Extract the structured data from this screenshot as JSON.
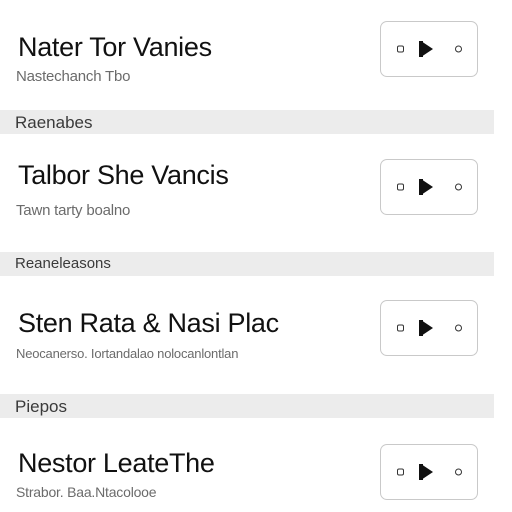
{
  "rows": [
    {
      "title": "Nater Tor Vanies",
      "subtitle": "Nastechanch Tbo"
    },
    {
      "title": "Talbor She Vancis",
      "subtitle": "Tawn tarty boalno"
    },
    {
      "title": "Sten Rata & Nasi Plac",
      "subtitle": "Neocanerso. Iortandalao nolocanlontlan"
    },
    {
      "title": "Nestor LeateThe",
      "subtitle": "Strabor. Baa.Ntacolooe"
    }
  ],
  "sections": [
    {
      "label": "Raenabes"
    },
    {
      "label": "Reaneleasons"
    },
    {
      "label": "Piepos"
    }
  ],
  "control_icons": {
    "left": "square-dot-icon",
    "center": "play-icon",
    "right": "circle-dot-icon"
  }
}
